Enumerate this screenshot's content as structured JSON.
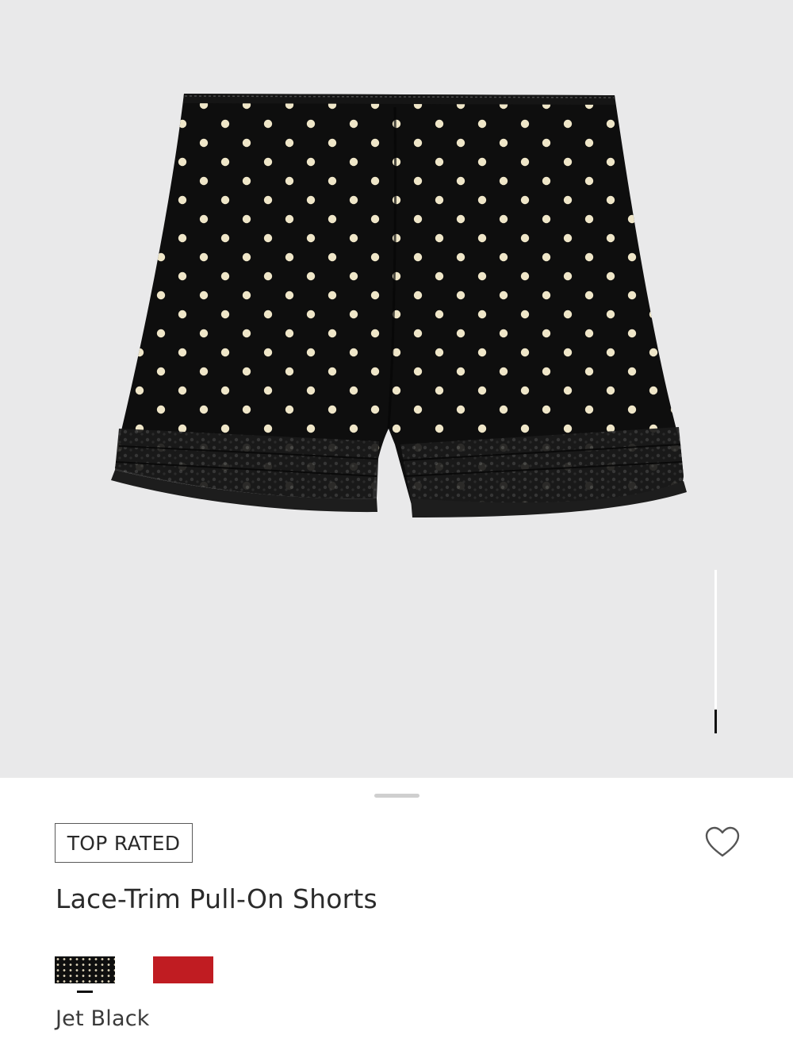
{
  "product": {
    "badge": "TOP RATED",
    "title": "Lace-Trim Pull-On Shorts",
    "selected_color": "Jet Black"
  },
  "gallery": {
    "image": "polka-dot-shorts",
    "background": "#e9e9ea",
    "scroll_progress": 0.93
  },
  "swatches": [
    {
      "name": "Jet Black",
      "pattern": "polka-dot",
      "color": "#0f0f0f",
      "selected": true
    },
    {
      "name": "red-swatch",
      "pattern": "solid",
      "color": "#c01c22",
      "selected": false
    }
  ],
  "icons": {
    "wishlist": "heart-outline-icon"
  }
}
